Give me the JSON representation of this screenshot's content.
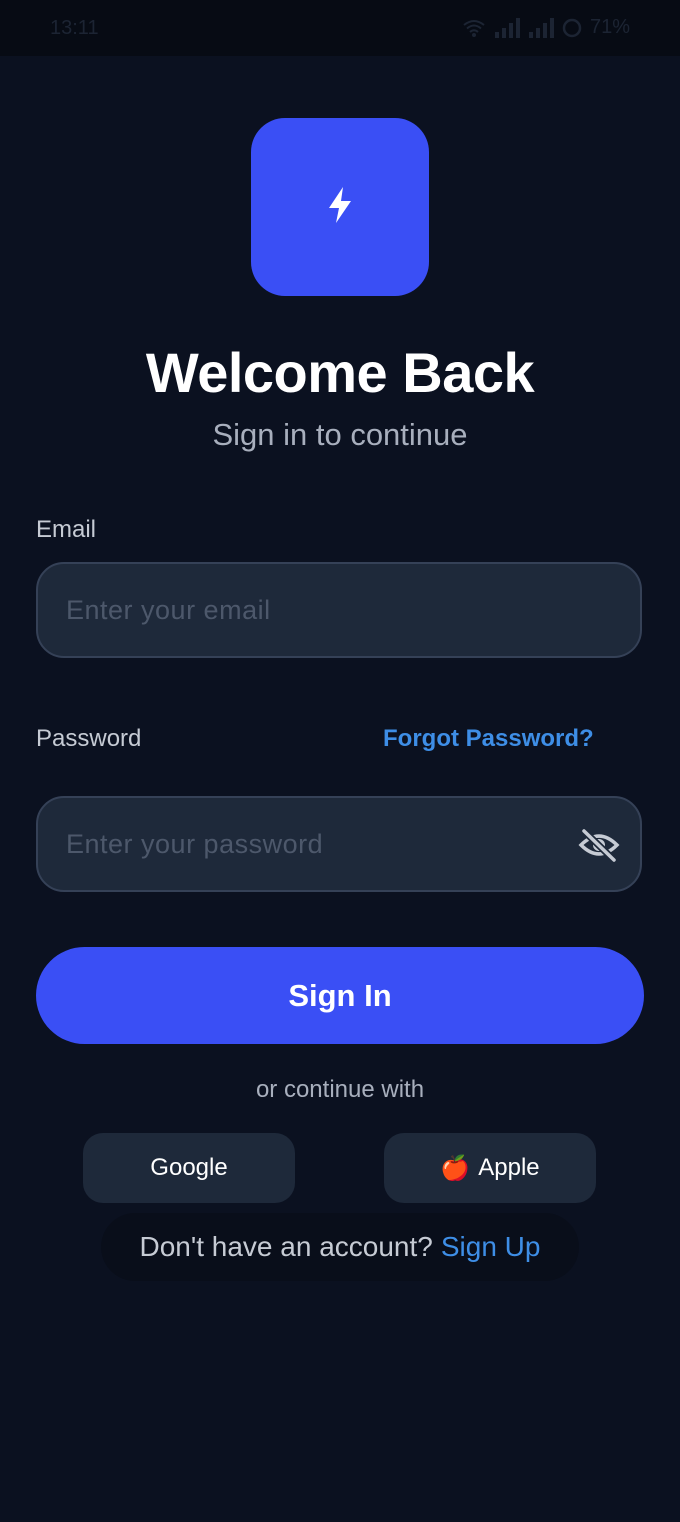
{
  "status_bar": {
    "time": "13:11",
    "battery": "71%"
  },
  "header": {
    "logo_icon": "lightning-bolt-icon",
    "title": "Welcome Back",
    "subtitle": "Sign in to continue"
  },
  "form": {
    "email_label": "Email",
    "email_placeholder": "Enter your email",
    "email_value": "",
    "password_label": "Password",
    "forgot_password": "Forgot Password?",
    "password_placeholder": "Enter your password",
    "password_value": "",
    "password_toggle_icon": "eye-off-icon",
    "submit_label": "Sign In"
  },
  "social": {
    "divider_text": "or continue with",
    "google_label": "Google",
    "apple_emoji": "🍎",
    "apple_label": "Apple"
  },
  "footer": {
    "prompt": "Don't have an account?",
    "signup_link": "Sign Up"
  },
  "colors": {
    "background": "#0b1120",
    "accent": "#3a4ff5",
    "link": "#3e8ee6",
    "field_background": "#1e293a"
  }
}
